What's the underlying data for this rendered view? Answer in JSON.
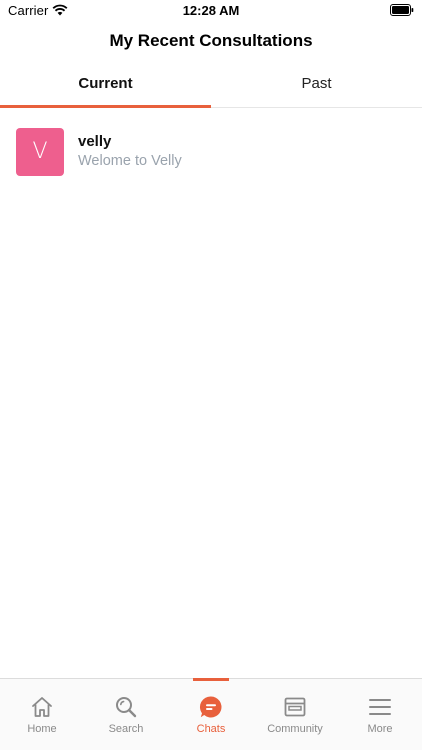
{
  "status_bar": {
    "carrier": "Carrier",
    "time": "12:28 AM"
  },
  "header": {
    "title": "My Recent Consultations"
  },
  "tabs": [
    {
      "label": "Current",
      "selected": true
    },
    {
      "label": "Past",
      "selected": false
    }
  ],
  "chats": [
    {
      "avatar_letter": "V",
      "avatar_color": "#ee5f8e",
      "name": "velly",
      "preview": "Welome to Velly"
    }
  ],
  "tabbar": {
    "items": [
      {
        "label": "Home",
        "icon": "home-icon"
      },
      {
        "label": "Search",
        "icon": "search-icon"
      },
      {
        "label": "Chats",
        "icon": "chat-bubble-icon",
        "active": true
      },
      {
        "label": "Community",
        "icon": "browser-window-icon"
      },
      {
        "label": "More",
        "icon": "hamburger-menu-icon"
      }
    ]
  },
  "colors": {
    "accent": "#e8603c",
    "inactive": "#8a8a8a",
    "preview_text": "#9aa3ad"
  }
}
